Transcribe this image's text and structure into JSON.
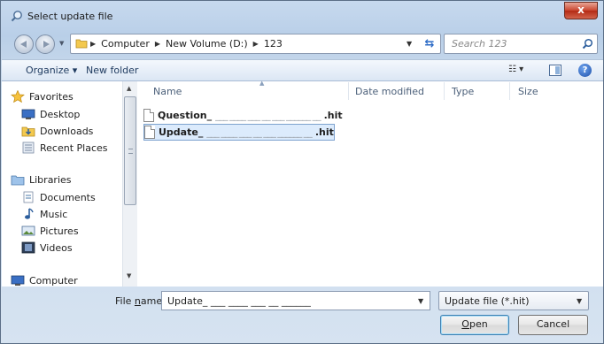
{
  "window": {
    "title": "Select update file",
    "close_label": "x"
  },
  "address": {
    "crumbs": [
      "Computer",
      "New Volume (D:)",
      "123"
    ],
    "search_placeholder": "Search 123"
  },
  "toolbar": {
    "organize": "Organize ▾",
    "new_folder": "New folder",
    "view": "☷ ▾",
    "help": "?"
  },
  "nav": {
    "favorites": "Favorites",
    "desktop": "Desktop",
    "downloads": "Downloads",
    "recent_places": "Recent Places",
    "libraries": "Libraries",
    "documents": "Documents",
    "music": "Music",
    "pictures": "Pictures",
    "videos": "Videos",
    "computer": "Computer"
  },
  "columns": {
    "name": "Name",
    "date_modified": "Date modified",
    "type": "Type",
    "size": "Size"
  },
  "files": [
    {
      "name_prefix": "Question_",
      "name_mask": "___ ____ ___ __ ___ ______ __",
      "name_ext": ".hit",
      "selected": false
    },
    {
      "name_prefix": "Update_",
      "name_mask": "___ ____ ___ __ ___ ______ __",
      "name_ext": ".hit",
      "selected": true
    }
  ],
  "bottom": {
    "file_name_label_pre": "File ",
    "file_name_label_u": "n",
    "file_name_label_post": "ame:",
    "file_name_value": "Update_ ___ ____ ___ __ ______",
    "filter_value": "Update file (*.hit)",
    "open_pre": "",
    "open_u": "O",
    "open_post": "pen",
    "cancel": "Cancel"
  }
}
